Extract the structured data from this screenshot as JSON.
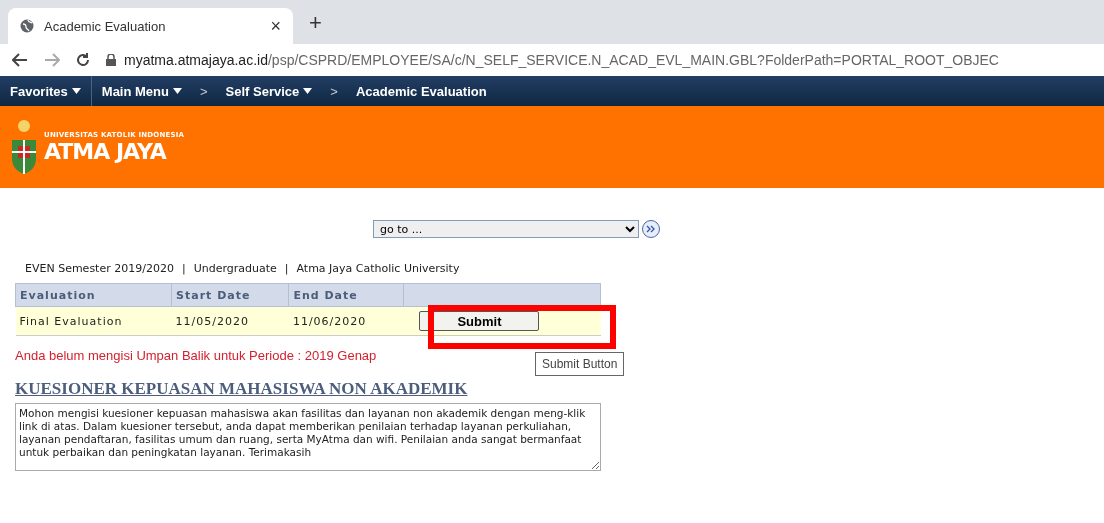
{
  "browser": {
    "tab_title": "Academic Evaluation",
    "tab_close": "×",
    "new_tab": "+",
    "url_host": "myatma.atmajaya.ac.id",
    "url_path": "/psp/CSPRD/EMPLOYEE/SA/c/N_SELF_SERVICE.N_ACAD_EVL_MAIN.GBL?FolderPath=PORTAL_ROOT_OBJEC"
  },
  "nav": [
    {
      "kind": "menu",
      "label": "Favorites"
    },
    {
      "kind": "menu",
      "label": "Main Menu"
    },
    {
      "kind": "sep",
      "label": ">"
    },
    {
      "kind": "menu",
      "label": "Self Service"
    },
    {
      "kind": "sep",
      "label": ">"
    },
    {
      "kind": "crumb",
      "label": "Academic Evaluation"
    }
  ],
  "banner": {
    "tagline": "UNIVERSITAS KATOLIK INDONESIA",
    "name": "ATMA JAYA"
  },
  "goto": {
    "value": "go to ..."
  },
  "info": [
    "EVEN Semester 2019/2020",
    "|",
    "Undergraduate",
    "|",
    "Atma Jaya Catholic University"
  ],
  "table": {
    "columns": [
      "Evaluation",
      "Start Date",
      "End Date",
      ""
    ],
    "rows": [
      {
        "cells": [
          "Final Evaluation",
          "11/05/2020",
          "11/06/2020"
        ],
        "button": "Submit"
      }
    ]
  },
  "tooltip": "Submit Button",
  "notice": "Anda belum mengisi Umpan Balik untuk Periode :  2019 Genap",
  "heading": "KUESIONER KEPUASAN MAHASISWA NON AKADEMIK",
  "description": "Mohon mengisi kuesioner kepuasan mahasiswa akan fasilitas dan layanan non akademik dengan meng-klik link di atas. Dalam kuesioner tersebut, anda dapat memberikan penilaian terhadap layanan perkuliahan, layanan pendaftaran, fasilitas umum dan ruang, serta MyAtma dan wifi. Penilaian anda sangat bermanfaat untuk perbaikan dan peningkatan layanan. Terimakasih"
}
